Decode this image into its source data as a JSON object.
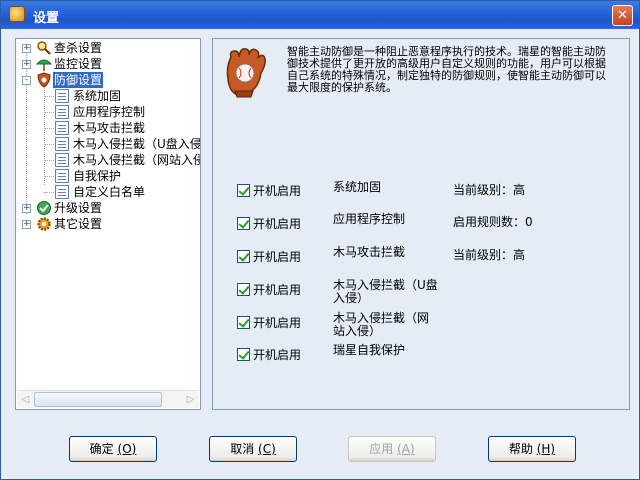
{
  "window": {
    "title": "设置"
  },
  "tree": [
    {
      "label": "查杀设置",
      "icon": "scan-magnifier-icon",
      "expander": "+"
    },
    {
      "label": "监控设置",
      "icon": "monitor-umbrella-icon",
      "expander": "+"
    },
    {
      "label": "防御设置",
      "icon": "defense-shield-icon",
      "expander": "-",
      "selected": true
    },
    {
      "label": "系统加固",
      "icon": "doc-icon"
    },
    {
      "label": "应用程序控制",
      "icon": "doc-icon"
    },
    {
      "label": "木马攻击拦截",
      "icon": "doc-icon"
    },
    {
      "label": "木马入侵拦截（U盘入侵",
      "icon": "doc-icon"
    },
    {
      "label": "木马入侵拦截（网站入侵",
      "icon": "doc-icon"
    },
    {
      "label": "自我保护",
      "icon": "doc-icon"
    },
    {
      "label": "自定义白名单",
      "icon": "doc-icon"
    },
    {
      "label": "升级设置",
      "icon": "upgrade-globe-icon",
      "expander": "+"
    },
    {
      "label": "其它设置",
      "icon": "other-gear-icon",
      "expander": "+"
    }
  ],
  "description": "智能主动防御是一种阻止恶意程序执行的技术。瑞星的智能主动防御技术提供了更开放的高级用户自定义规则的功能，用户可以根据自己系统的特殊情况，制定独特的防御规则，使智能主动防御可以最大限度的保护系统。",
  "rows": [
    {
      "checkbox_label": "开机启用",
      "checked": true,
      "feature": "系统加固",
      "status": "当前级别：高"
    },
    {
      "checkbox_label": "开机启用",
      "checked": true,
      "feature": "应用程序控制",
      "status": "启用规则数：0"
    },
    {
      "checkbox_label": "开机启用",
      "checked": true,
      "feature": "木马攻击拦截",
      "status": "当前级别：高"
    },
    {
      "checkbox_label": "开机启用",
      "checked": true,
      "feature": "木马入侵拦截（U盘入侵）",
      "status": ""
    },
    {
      "checkbox_label": "开机启用",
      "checked": true,
      "feature": "木马入侵拦截（网站入侵）",
      "status": ""
    },
    {
      "checkbox_label": "开机启用",
      "checked": true,
      "feature": "瑞星自我保护",
      "status": ""
    }
  ],
  "buttons": {
    "ok": {
      "label": "确定",
      "hotkey": "(O)"
    },
    "cancel": {
      "label": "取消",
      "hotkey": "(C)"
    },
    "apply": {
      "label": "应用",
      "hotkey": "(A)"
    },
    "help": {
      "label": "帮助",
      "hotkey": "(H)"
    }
  },
  "colors": {
    "titlebar": "#2462D6",
    "selection": "#316AC5",
    "check": "#21A121"
  }
}
